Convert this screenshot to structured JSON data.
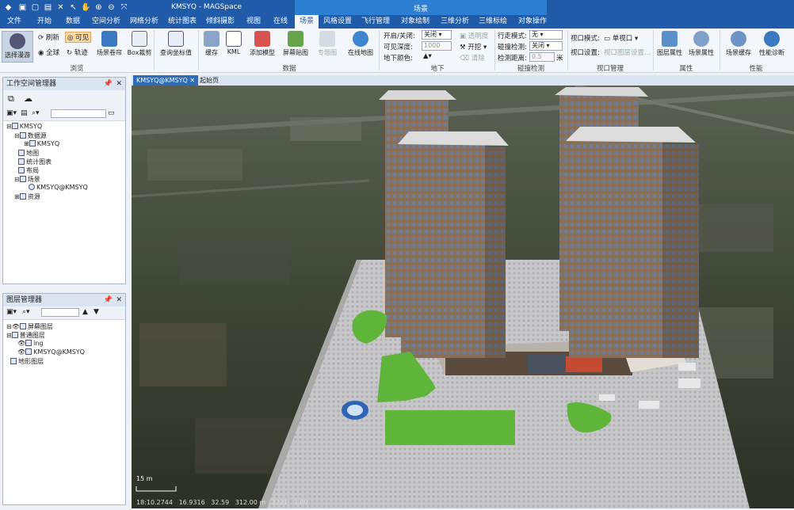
{
  "window": {
    "app_title": "KMSYQ - MAGSpace",
    "context_title": "场景"
  },
  "menu": [
    "文件",
    "开始",
    "数据",
    "空间分析",
    "网络分析",
    "统计图表",
    "倾斜摄影",
    "视图",
    "在线",
    "场景",
    "风格设置",
    "飞行管理",
    "对象绘制",
    "三维分析",
    "三维标绘",
    "对象操作"
  ],
  "active_menu": "场景",
  "ribbon": {
    "browse": {
      "select_roam": "选择漫游",
      "refresh": "刷新",
      "visible": "可见",
      "globe": "全球",
      "track": "轨迹",
      "scene_shutter": "场景卷帘",
      "box_clip": "Box裁剪",
      "group": "浏览"
    },
    "query": {
      "query_coord": "查询坐标值"
    },
    "data": {
      "cache": "缓存",
      "kml": "KML",
      "add_model": "添加模型",
      "screen_map": "屏幕贴图",
      "thematic": "专题图",
      "online_map": "在线地图",
      "group": "数据"
    },
    "underground": {
      "on_off_label": "开启/关闭:",
      "on_off_value": "关闭",
      "visible_depth_label": "可见深度:",
      "visible_depth_value": "1000",
      "ground_color_label": "地下颜色:",
      "transparency": "透明度",
      "excavate": "开挖",
      "clear": "清除",
      "group": "地下"
    },
    "collision": {
      "walk_mode_label": "行走模式:",
      "walk_mode_value": "无",
      "collision_label": "碰撞检测:",
      "collision_value": "关闭",
      "distance_label": "检测距离:",
      "distance_value": "0.5",
      "distance_unit": "米",
      "group": "碰撞检测"
    },
    "viewport": {
      "mode_label": "视口模式:",
      "mode_value": "单视口",
      "settings_label": "视口设置:",
      "settings_value": "视口图层设置...",
      "group": "视口管理"
    },
    "properties": {
      "layer_props": "图层属性",
      "scene_props": "场景属性",
      "group": "属性"
    },
    "performance": {
      "scene_cache": "场景缓存",
      "perf_diag": "性能诊断",
      "group": "性能"
    }
  },
  "workspace_panel": {
    "title": "工作空间管理器",
    "tree": [
      {
        "label": "KMSYQ",
        "level": 0
      },
      {
        "label": "数据源",
        "level": 1
      },
      {
        "label": "KMSYQ",
        "level": 2
      },
      {
        "label": "地图",
        "level": 1
      },
      {
        "label": "统计图表",
        "level": 1
      },
      {
        "label": "布局",
        "level": 1
      },
      {
        "label": "场景",
        "level": 1
      },
      {
        "label": "KMSYQ@KMSYQ",
        "level": 2
      },
      {
        "label": "资源",
        "level": 1
      }
    ]
  },
  "layer_panel": {
    "title": "图层管理器",
    "tree": [
      {
        "label": "屏幕图层",
        "level": 0
      },
      {
        "label": "普通图层",
        "level": 0
      },
      {
        "label": "ing",
        "level": 1
      },
      {
        "label": "KMSYQ@KMSYQ",
        "level": 1
      },
      {
        "label": "地形图层",
        "level": 0
      }
    ]
  },
  "view_tabs": [
    {
      "label": "KMSYQ@KMSYQ",
      "active": true
    },
    {
      "label": "起始页",
      "active": false
    }
  ],
  "status_bar": {
    "scale": "15 m",
    "text": "18:10.2744   16.9316   32.59   312.00 m   2231   1.00"
  },
  "colors": {
    "brand": "#1f5ba8",
    "context_tab": "#2d7fd3",
    "ribbon_bg": "#f3f6fa",
    "grass": "#5fb53a",
    "plaza": "#cfcfcf"
  }
}
